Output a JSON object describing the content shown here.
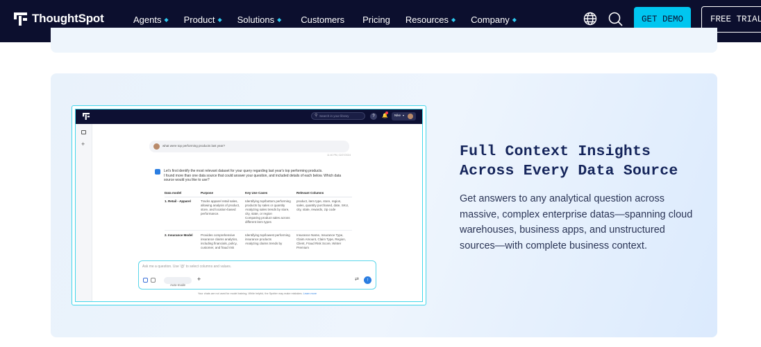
{
  "nav": {
    "logo_text": "ThoughtSpot",
    "items": [
      {
        "label": "Agents",
        "has_dropdown": true
      },
      {
        "label": "Product",
        "has_dropdown": true
      },
      {
        "label": "Solutions",
        "has_dropdown": true
      },
      {
        "label": "Customers",
        "has_dropdown": false
      },
      {
        "label": "Pricing",
        "has_dropdown": false
      },
      {
        "label": "Resources",
        "has_dropdown": true
      },
      {
        "label": "Company",
        "has_dropdown": true
      }
    ],
    "get_demo": "GET DEMO",
    "free_trial": "FREE TRIAL",
    "icons": [
      "globe-icon",
      "search-icon"
    ]
  },
  "feature": {
    "title": "Full Context Insights Across Every Data Source",
    "description": "Get answers to any analytical question across massive, complex enterprise datas—spanning cloud warehouses, business apps, and unstructured sources—with complete business context."
  },
  "screenshot": {
    "search_placeholder": "Search in your library",
    "user_name": "Nike",
    "user_question": "what were top performing products last year?",
    "timestamp": "11:40 PM, 02/27/2024",
    "ai_intro": "Let's first identify the most relevant dataset for your query regarding last year's top performing products.",
    "ai_intro2": "I found more than one data source that could answer your question, and included details of each below. Which data source would you like to use?",
    "table_headers": [
      "Data model",
      "Purpose",
      "Key Use Cases",
      "Relevant Columns"
    ],
    "rows": [
      {
        "model": "1. Retail - Apparel",
        "purpose": "Tracks apparel retail sales, allowing analysis of product, store, and location-based performance.",
        "use_cases": [
          "Identifying top/bottom performing products by sales or quantity",
          "Analyzing sales trends by store, city, state, or region",
          "Comparing product sales across different item types"
        ],
        "columns": "product, item type, store, region, sales, quantity purchased, date, SKU, city, state, rewards, zip code"
      },
      {
        "model": "2. Insurance Model",
        "purpose": "Provides comprehensive insurance claims analytics, including financials, policy, customer, and fraud risk",
        "use_cases": [
          "Identifying top/lowest performing insurance products",
          "Analyzing claims trends by"
        ],
        "columns": "Insurance Name, Insurance Type, Claim Amount, Claim Type, Region, Client, Fraud Risk Score, Winter Premium"
      }
    ],
    "prompt_placeholder": "Ask me a question. Use '@' to select columns and values.",
    "mode_label": "Auto-mode",
    "disclaimer": "Your chats are not used for model training. While helpful, the Spotter may make mistakes.",
    "learn_more": "Learn more"
  }
}
